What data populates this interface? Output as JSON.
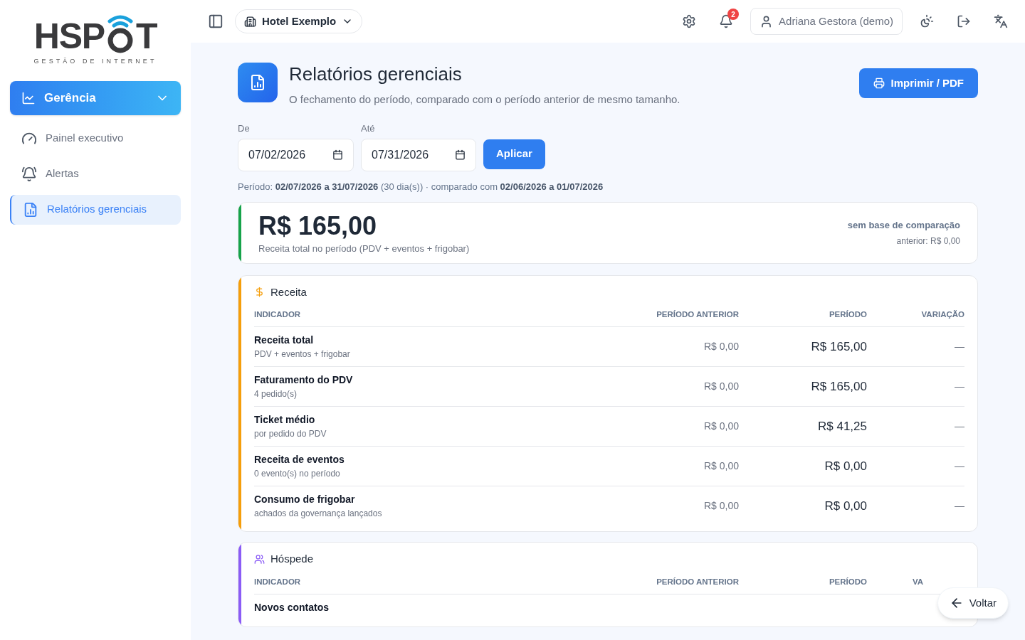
{
  "logo": {
    "wordmark_left": "HSP",
    "wordmark_right": "T",
    "tagline": "GESTÃO DE INTERNET"
  },
  "sidebar": {
    "group": {
      "label": "Gerência",
      "expanded": true
    },
    "items": [
      {
        "label": "Painel executivo",
        "selected": false
      },
      {
        "label": "Alertas",
        "selected": false
      },
      {
        "label": "Relatórios gerenciais",
        "selected": true
      }
    ]
  },
  "topbar": {
    "hotel": "Hotel Exemplo",
    "notifications": "2",
    "user": "Adriana Gestora (demo)"
  },
  "page": {
    "title": "Relatórios gerenciais",
    "subtitle": "O fechamento do período, comparado com o período anterior de mesmo tamanho.",
    "print_button": "Imprimir / PDF"
  },
  "filters": {
    "from_label": "De",
    "from_value": "07/02/2026",
    "to_label": "Até",
    "to_value": "07/31/2026",
    "apply": "Aplicar"
  },
  "period_line": "Período: **02/07/2026 a 31/07/2026** (30 dia(s)) · comparado com **02/06/2026 a 01/07/2026**",
  "summary": {
    "value": "R$ 165,00",
    "caption": "Receita total no período (PDV + eventos + frigobar)",
    "comparison": "sem base de comparação",
    "previous": "anterior: R$ 0,00",
    "color": "#16a34a"
  },
  "sections": [
    {
      "title": "Receita",
      "color": "#f59e0b",
      "columns": [
        "INDICADOR",
        "PERÍODO ANTERIOR",
        "PERÍODO",
        "VARIAÇÃO"
      ],
      "rows": [
        {
          "name": "Receita total",
          "note": "PDV + eventos + frigobar",
          "previous": "R$ 0,00",
          "current": "R$ 165,00",
          "change": "—"
        },
        {
          "name": "Faturamento do PDV",
          "note": "4 pedido(s)",
          "previous": "R$ 0,00",
          "current": "R$ 165,00",
          "change": "—"
        },
        {
          "name": "Ticket médio",
          "note": "por pedido do PDV",
          "previous": "R$ 0,00",
          "current": "R$ 41,25",
          "change": "—"
        },
        {
          "name": "Receita de eventos",
          "note": "0 evento(s) no período",
          "previous": "R$ 0,00",
          "current": "R$ 0,00",
          "change": "—"
        },
        {
          "name": "Consumo de frigobar",
          "note": "achados da governança lançados",
          "previous": "R$ 0,00",
          "current": "R$ 0,00",
          "change": "—"
        }
      ]
    },
    {
      "title": "Hóspede",
      "color": "#8b5cf6",
      "columns": [
        "INDICADOR",
        "PERÍODO ANTERIOR",
        "PERÍODO",
        "VA"
      ],
      "rows": [
        {
          "name": "Novos contatos"
        }
      ]
    }
  ],
  "back_button": "Voltar"
}
